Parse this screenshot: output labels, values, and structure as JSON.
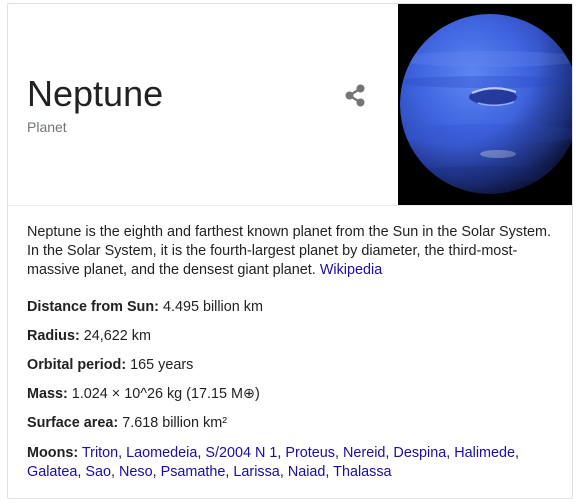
{
  "entity": {
    "title": "Neptune",
    "subtitle": "Planet"
  },
  "share": {
    "icon": "share-icon"
  },
  "image": {
    "icon": "neptune-planet-image",
    "planet_color": "#3a5fd8",
    "background": "#000000"
  },
  "description": {
    "text": "Neptune is the eighth and farthest known planet from the Sun in the Solar System. In the Solar System, it is the fourth-largest planet by diameter, the third-most-massive planet, and the densest giant planet.",
    "source_link": "Wikipedia"
  },
  "facts": {
    "distance": {
      "label": "Distance from Sun:",
      "value": "4.495 billion km"
    },
    "radius": {
      "label": "Radius:",
      "value": "24,622 km"
    },
    "orbital_period": {
      "label": "Orbital period:",
      "value": "165 years"
    },
    "mass": {
      "label": "Mass:",
      "value": "1.024 × 10^26 kg (17.15 M⊕)"
    },
    "surface_area": {
      "label": "Surface area:",
      "value": "7.618 billion km²"
    }
  },
  "moons": {
    "label": "Moons:",
    "items": [
      "Triton",
      "Laomedeia",
      "S/2004 N 1",
      "Proteus",
      "Nereid",
      "Despina",
      "Halimede",
      "Galatea",
      "Sao",
      "Neso",
      "Psamathe",
      "Larissa",
      "Naiad",
      "Thalassa"
    ]
  },
  "colors": {
    "link": "#1a0dab",
    "text": "#222222",
    "muted": "#70757a",
    "border": "#dfe1e5"
  }
}
